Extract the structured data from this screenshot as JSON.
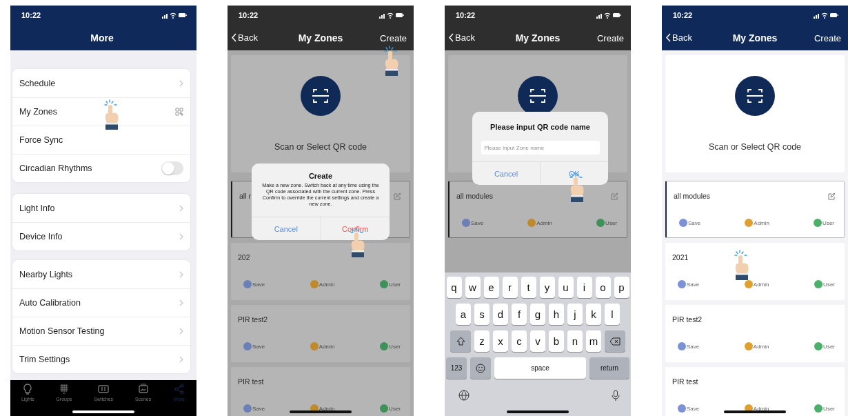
{
  "phones": [
    {
      "kind": "menu",
      "time": "10:22",
      "title": "More",
      "groups": [
        {
          "items": [
            {
              "label": "Schedule",
              "kind": "chevron",
              "tapped": false
            },
            {
              "label": "My Zones",
              "kind": "qr",
              "tapped": true
            },
            {
              "label": "Force Sync",
              "kind": "plain",
              "tapped": false
            },
            {
              "label": "Circadian Rhythms",
              "kind": "toggle",
              "on": false,
              "tapped": false
            }
          ]
        },
        {
          "items": [
            {
              "label": "Light Info",
              "kind": "chevron",
              "tapped": false
            },
            {
              "label": "Device Info",
              "kind": "chevron",
              "tapped": false
            }
          ]
        },
        {
          "items": [
            {
              "label": "Nearby Lights",
              "kind": "chevron",
              "tapped": false
            },
            {
              "label": "Auto Calibration",
              "kind": "chevron",
              "tapped": false
            },
            {
              "label": "Motion Sensor Testing",
              "kind": "chevron",
              "tapped": false
            },
            {
              "label": "Trim Settings",
              "kind": "chevron",
              "tapped": false
            }
          ]
        }
      ],
      "tabbar": [
        {
          "label": "Lights",
          "selected": false
        },
        {
          "label": "Groups",
          "selected": false
        },
        {
          "label": "Switches",
          "selected": false
        },
        {
          "label": "Scenes",
          "selected": false
        },
        {
          "label": "More",
          "selected": true
        }
      ]
    },
    {
      "kind": "zones",
      "time": "10:22",
      "nav": {
        "back": "Back",
        "title": "My Zones",
        "action": "Create",
        "action_tapped": true
      },
      "scan_label": "Scan or Select QR code",
      "zones": [
        {
          "name": "all r",
          "selected": true,
          "editable": true,
          "tapped": false
        },
        {
          "name": "202",
          "selected": false,
          "editable": false,
          "tapped": false,
          "actions": [
            {
              "label": "Save",
              "color": "#6b7fb8"
            },
            {
              "label": "Admin",
              "color": "#c08a2c"
            },
            {
              "label": "User",
              "color": "#3f915a"
            }
          ]
        },
        {
          "name": "PIR test2",
          "selected": false,
          "editable": false,
          "tapped": false,
          "actions": [
            {
              "label": "Save",
              "color": "#6b7fb8"
            },
            {
              "label": "Admin",
              "color": "#c08a2c"
            },
            {
              "label": "User",
              "color": "#3f915a"
            }
          ]
        },
        {
          "name": "PIR test",
          "selected": false,
          "editable": false,
          "tapped": false,
          "actions": [
            {
              "label": "Save",
              "color": "#6b7fb8"
            },
            {
              "label": "Admin",
              "color": "#c08a2c"
            },
            {
              "label": "User",
              "color": "#3f915a"
            }
          ]
        }
      ],
      "dialog": {
        "kind": "confirm",
        "title": "Create",
        "message": "Make a new zone. Switch back at any time using the QR code associated with the current zone. Press Confirm to override the current settings and create a new zone.",
        "buttons": [
          {
            "label": "Cancel",
            "kind": "cancel",
            "tapped": false
          },
          {
            "label": "Confirm",
            "kind": "destructive",
            "tapped": true
          }
        ]
      }
    },
    {
      "kind": "zones",
      "time": "10:22",
      "nav": {
        "back": "Back",
        "title": "My Zones",
        "action": "Create",
        "action_tapped": false
      },
      "zones": [
        {
          "name": "all modules",
          "selected": true,
          "editable": true,
          "tapped": false,
          "actions": [
            {
              "label": "Save",
              "color": "#6b7fb8"
            },
            {
              "label": "Admin",
              "color": "#c08a2c"
            },
            {
              "label": "User",
              "color": "#3f915a"
            }
          ]
        }
      ],
      "dialog": {
        "kind": "input",
        "title": "Please input QR code name",
        "placeholder": "Please input Zone name",
        "buttons": [
          {
            "label": "Cancel",
            "kind": "cancel",
            "tapped": false
          },
          {
            "label": "OK",
            "kind": "default",
            "tapped": true
          }
        ]
      },
      "keyboard": {
        "rows": [
          {
            "keys": [
              {
                "kind": "letter",
                "label": "q"
              },
              {
                "kind": "letter",
                "label": "w"
              },
              {
                "kind": "letter",
                "label": "e"
              },
              {
                "kind": "letter",
                "label": "r"
              },
              {
                "kind": "letter",
                "label": "t"
              },
              {
                "kind": "letter",
                "label": "y"
              },
              {
                "kind": "letter",
                "label": "u"
              },
              {
                "kind": "letter",
                "label": "i"
              },
              {
                "kind": "letter",
                "label": "o"
              },
              {
                "kind": "letter",
                "label": "p"
              }
            ]
          },
          {
            "keys": [
              {
                "kind": "letter",
                "label": "a"
              },
              {
                "kind": "letter",
                "label": "s"
              },
              {
                "kind": "letter",
                "label": "d"
              },
              {
                "kind": "letter",
                "label": "f"
              },
              {
                "kind": "letter",
                "label": "g"
              },
              {
                "kind": "letter",
                "label": "h"
              },
              {
                "kind": "letter",
                "label": "j"
              },
              {
                "kind": "letter",
                "label": "k"
              },
              {
                "kind": "letter",
                "label": "l"
              }
            ]
          },
          {
            "keys": [
              {
                "kind": "shift"
              },
              {
                "kind": "letter",
                "label": "z"
              },
              {
                "kind": "letter",
                "label": "x"
              },
              {
                "kind": "letter",
                "label": "c"
              },
              {
                "kind": "letter",
                "label": "v"
              },
              {
                "kind": "letter",
                "label": "b"
              },
              {
                "kind": "letter",
                "label": "n"
              },
              {
                "kind": "letter",
                "label": "m"
              },
              {
                "kind": "delete"
              }
            ]
          },
          {
            "keys": [
              {
                "kind": "mode",
                "label": "123"
              },
              {
                "kind": "emoji"
              },
              {
                "kind": "space",
                "label": "space"
              },
              {
                "kind": "return",
                "label": "return"
              }
            ]
          }
        ]
      }
    },
    {
      "kind": "zones",
      "time": "10:22",
      "nav": {
        "back": "Back",
        "title": "My Zones",
        "action": "Create",
        "action_tapped": false
      },
      "scan_label": "Scan or Select QR code",
      "zones": [
        {
          "name": "all modules",
          "selected": true,
          "editable": true,
          "tapped": false,
          "actions": [
            {
              "label": "Save",
              "color": "#7b93d6"
            },
            {
              "label": "Admin",
              "color": "#e0a030"
            },
            {
              "label": "User",
              "color": "#4caf6a"
            }
          ]
        },
        {
          "name": "2021",
          "selected": false,
          "editable": false,
          "tapped": true,
          "actions": [
            {
              "label": "Save",
              "color": "#7b93d6"
            },
            {
              "label": "Admin",
              "color": "#e0a030"
            },
            {
              "label": "User",
              "color": "#4caf6a"
            }
          ]
        },
        {
          "name": "PIR test2",
          "selected": false,
          "editable": false,
          "tapped": false,
          "actions": [
            {
              "label": "Save",
              "color": "#7b93d6"
            },
            {
              "label": "Admin",
              "color": "#e0a030"
            },
            {
              "label": "User",
              "color": "#4caf6a"
            }
          ]
        },
        {
          "name": "PIR test",
          "selected": false,
          "editable": false,
          "tapped": false,
          "actions": [
            {
              "label": "Save",
              "color": "#7b93d6"
            },
            {
              "label": "Admin",
              "color": "#e0a030"
            },
            {
              "label": "User",
              "color": "#4caf6a"
            }
          ]
        }
      ]
    }
  ]
}
